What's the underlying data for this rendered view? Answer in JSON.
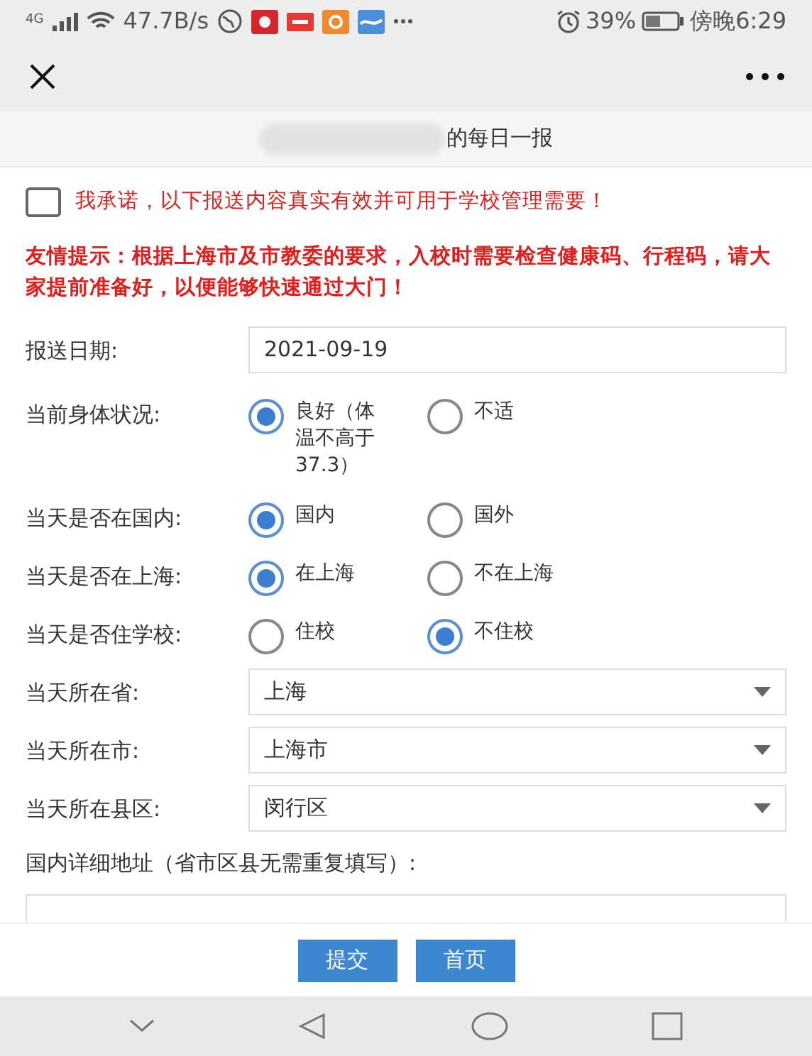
{
  "status_bar": {
    "network": "4G",
    "speed": "47.7B/s",
    "battery": "39%",
    "time": "傍晚6:29"
  },
  "page_title": "的每日一报",
  "pledge": {
    "text": "我承诺，以下报送内容真实有效并可用于学校管理需要！",
    "checked": false
  },
  "notice": "友情提示：根据上海市及市教委的要求，入校时需要检查健康码、行程码，请大家提前准备好，以便能够快速通过大门！",
  "fields": [
    {
      "kind": "input",
      "label": "报送日期:",
      "value": "2021-09-19"
    },
    {
      "kind": "radio",
      "label": "当前身体状况:",
      "options": [
        {
          "label": "良好（体温不高于37.3）",
          "selected": true
        },
        {
          "label": "不适",
          "selected": false
        }
      ]
    },
    {
      "kind": "radio",
      "label": "当天是否在国内:",
      "options": [
        {
          "label": "国内",
          "selected": true
        },
        {
          "label": "国外",
          "selected": false
        }
      ]
    },
    {
      "kind": "radio",
      "label": "当天是否在上海:",
      "options": [
        {
          "label": "在上海",
          "selected": true
        },
        {
          "label": "不在上海",
          "selected": false
        }
      ]
    },
    {
      "kind": "radio",
      "label": "当天是否住学校:",
      "options": [
        {
          "label": "住校",
          "selected": false
        },
        {
          "label": "不住校",
          "selected": true
        }
      ]
    },
    {
      "kind": "select",
      "label": "当天所在省:",
      "value": "上海"
    },
    {
      "kind": "select",
      "label": "当天所在市:",
      "value": "上海市"
    },
    {
      "kind": "select",
      "label": "当天所在县区:",
      "value": "闵行区"
    }
  ],
  "address_label": "国内详细地址（省市区县无需重复填写）:",
  "buttons": [
    "提交",
    "首页"
  ]
}
